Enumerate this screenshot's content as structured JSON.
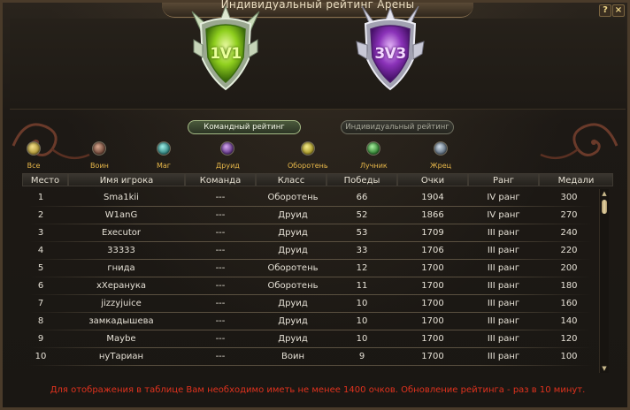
{
  "window": {
    "title": "Индивидуальный рейтинг Арены",
    "help_label": "?",
    "close_label": "×"
  },
  "emblems": {
    "one_v_one": "1V1",
    "three_v_three": "3V3"
  },
  "tabs": {
    "team": "Командный рейтинг",
    "individual": "Индивидуальный рейтинг"
  },
  "class_filters": [
    {
      "label": "Все",
      "color": "#b8a040"
    },
    {
      "label": "Воин",
      "color": "#7a5040"
    },
    {
      "label": "Маг",
      "color": "#3a8e8a"
    },
    {
      "label": "Друид",
      "color": "#6a3e8e"
    },
    {
      "label": "Оборотень",
      "color": "#b0a030"
    },
    {
      "label": "Лучник",
      "color": "#3a8a3a"
    },
    {
      "label": "Жрец",
      "color": "#6a7a8a"
    }
  ],
  "table": {
    "headers": [
      "Место",
      "Имя игрока",
      "Команда",
      "Класс",
      "Победы",
      "Очки",
      "Ранг",
      "Медали"
    ],
    "rows": [
      [
        "1",
        "Sma1kii",
        "---",
        "Оборотень",
        "66",
        "1904",
        "IV ранг",
        "300"
      ],
      [
        "2",
        "W1anG",
        "---",
        "Друид",
        "52",
        "1866",
        "IV ранг",
        "270"
      ],
      [
        "3",
        "Executor",
        "---",
        "Друид",
        "53",
        "1709",
        "III ранг",
        "240"
      ],
      [
        "4",
        "33333",
        "---",
        "Друид",
        "33",
        "1706",
        "III ранг",
        "220"
      ],
      [
        "5",
        "гнида",
        "---",
        "Оборотень",
        "12",
        "1700",
        "III ранг",
        "200"
      ],
      [
        "6",
        "xХеранука",
        "---",
        "Оборотень",
        "11",
        "1700",
        "III ранг",
        "180"
      ],
      [
        "7",
        "jizzyjuice",
        "---",
        "Друид",
        "10",
        "1700",
        "III ранг",
        "160"
      ],
      [
        "8",
        "замкадышева",
        "---",
        "Друид",
        "10",
        "1700",
        "III ранг",
        "140"
      ],
      [
        "9",
        "Maybe",
        "---",
        "Друид",
        "10",
        "1700",
        "III ранг",
        "120"
      ],
      [
        "10",
        "нуТариан",
        "---",
        "Воин",
        "9",
        "1700",
        "III ранг",
        "100"
      ]
    ]
  },
  "notice": "Для отображения в таблице Вам необходимо иметь не менее 1400 очков. Обновление рейтинга - раз в 10 минут.",
  "colors": {
    "accent_gold": "#e8b84a",
    "notice_red": "#e0321e",
    "emblem_green": "#9bd12a",
    "emblem_purple": "#b34ae6"
  }
}
